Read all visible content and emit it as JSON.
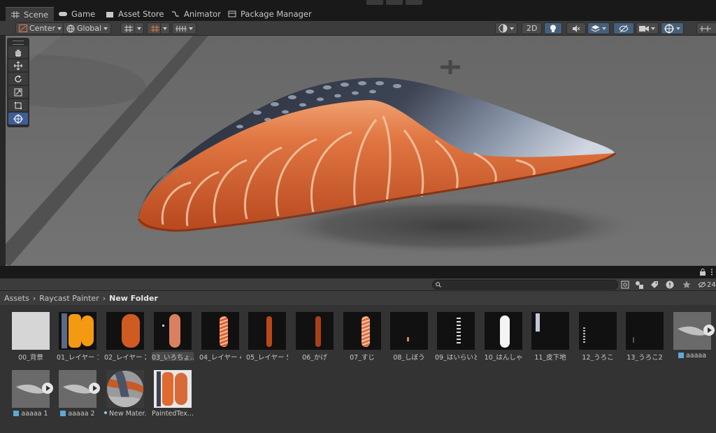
{
  "tabs": [
    {
      "label": "Scene",
      "icon": "grid-icon"
    },
    {
      "label": "Game",
      "icon": "gamepad-icon"
    },
    {
      "label": "Asset Store",
      "icon": "bag-icon"
    },
    {
      "label": "Animator",
      "icon": "animator-icon"
    },
    {
      "label": "Package Manager",
      "icon": "package-icon"
    }
  ],
  "toolbar": {
    "pivot_label": "Center",
    "space_label": "Global",
    "mode_2d_label": "2D"
  },
  "project": {
    "search_placeholder": "",
    "hidden_count": "24"
  },
  "breadcrumb": {
    "root": "Assets",
    "parent": "Raycast Painter",
    "current": "New Folder"
  },
  "assets": [
    {
      "label": "00_背景"
    },
    {
      "label": "01_レイヤー 1"
    },
    {
      "label": "02_レイヤー 2"
    },
    {
      "label": "03_いろちょ..."
    },
    {
      "label": "04_レイヤー 4"
    },
    {
      "label": "05_レイヤー 5"
    },
    {
      "label": "06_かげ"
    },
    {
      "label": "07_すじ"
    },
    {
      "label": "08_しぼう"
    },
    {
      "label": "09_はいらいと"
    },
    {
      "label": "10_はんしゃ"
    },
    {
      "label": "11_皮下地"
    },
    {
      "label": "12_うろこ"
    },
    {
      "label": "13_うろこ2"
    },
    {
      "label": "aaaaa"
    },
    {
      "label": "aaaaa 1"
    },
    {
      "label": "aaaaa 2"
    },
    {
      "label": "New Mater..."
    },
    {
      "label": "PaintedTex..."
    }
  ],
  "colors": {
    "salmon": "#d8683a",
    "skin": "#3d4453",
    "accent": "#3e5f96"
  }
}
